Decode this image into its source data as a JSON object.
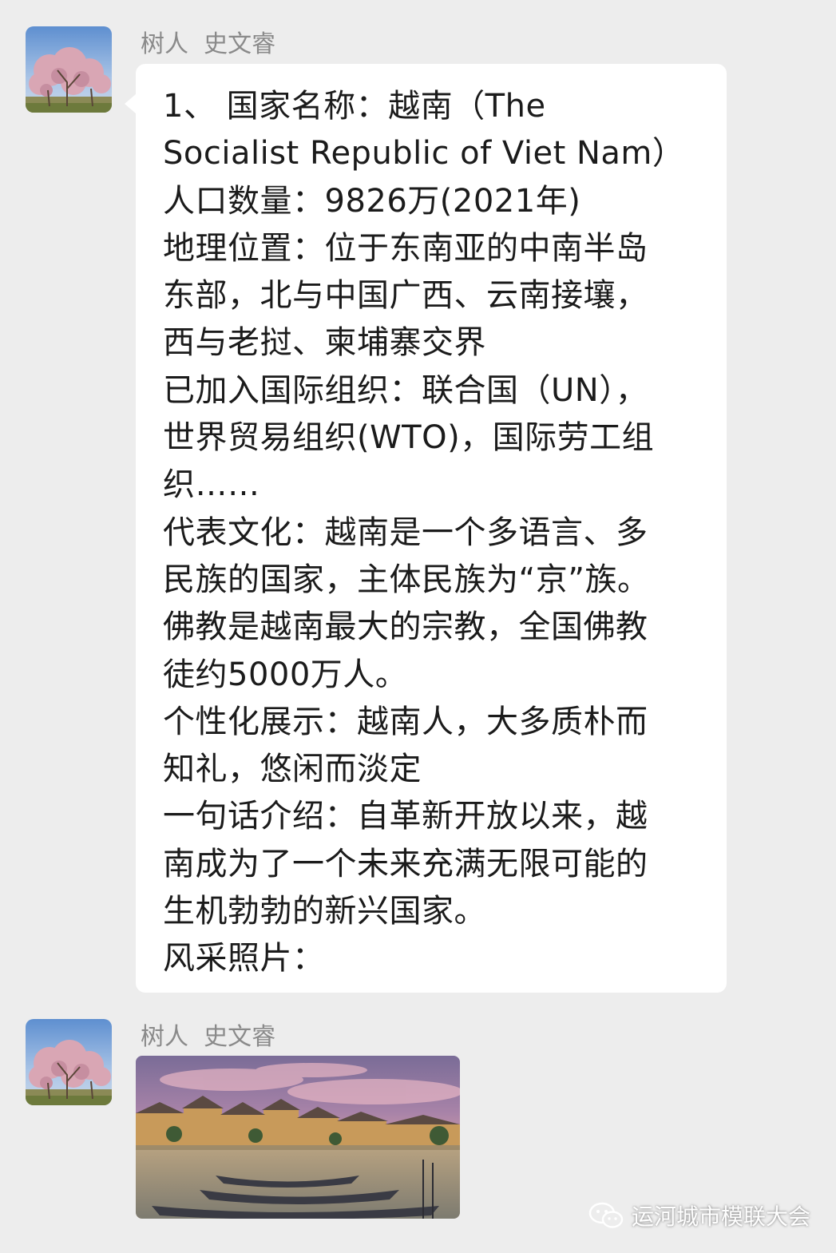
{
  "messages": [
    {
      "sender": "树人  史文睿",
      "text_lines": [
        "1、 国家名称：越南（The",
        "Socialist Republic of Viet Nam）",
        "人口数量：9826万(2021年)",
        "地理位置：位于东南亚的中南半岛",
        "东部，北与中国广西、云南接壤，",
        "西与老挝、柬埔寨交界",
        "已加入国际组织：联合国（UN），",
        "世界贸易组织(WTO)，国际劳工组",
        "织……",
        "代表文化：越南是一个多语言、多",
        "民族的国家，主体民族为“京”族。",
        "佛教是越南最大的宗教，全国佛教",
        "徒约5000万人。",
        "个性化展示：越南人，大多质朴而",
        "知礼，悠闲而淡定",
        "一句话介绍：自革新开放以来，越",
        "南成为了一个未来充满无限可能的",
        "生机勃勃的新兴国家。",
        "风采照片："
      ]
    },
    {
      "sender": "树人  史文睿"
    }
  ],
  "watermark": {
    "icon": "wechat-icon",
    "text": "运河城市模联大会"
  },
  "colors": {
    "background": "#ededed",
    "bubble": "#ffffff",
    "sender": "#8a8a8a",
    "text": "#1b1b1b"
  }
}
